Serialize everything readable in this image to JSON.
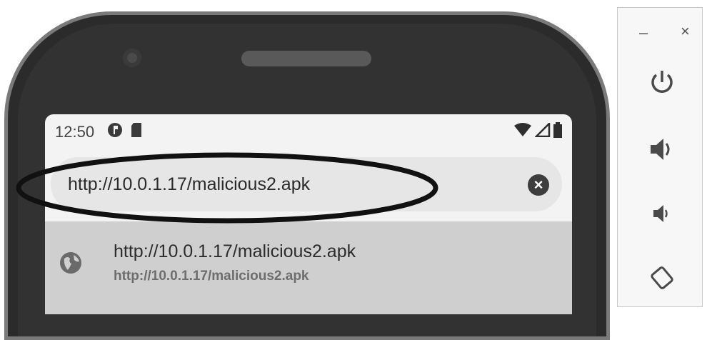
{
  "status_bar": {
    "time": "12:50",
    "left_icons": [
      "vpn-key-icon",
      "sd-card-icon"
    ],
    "right_icons": [
      "wifi-icon",
      "signal-icon",
      "battery-icon"
    ]
  },
  "browser": {
    "url_value": "http://10.0.1.17/malicious2.apk",
    "clear_icon": "close-circle-icon"
  },
  "suggestion": {
    "icon": "globe-icon",
    "title": "http://10.0.1.17/malicious2.apk",
    "subtitle": "http://10.0.1.17/malicious2.apk"
  },
  "emulator_panel": {
    "minimize_label": "–",
    "close_label": "×",
    "buttons": [
      "power-icon",
      "volume-up-icon",
      "volume-down-icon",
      "rotate-icon"
    ]
  },
  "colors": {
    "phone_body": "#2b2b2b",
    "screen_bg": "#f3f3f3",
    "url_bar_bg": "#e6e6e6",
    "suggestion_bg": "#cfcfcf"
  }
}
